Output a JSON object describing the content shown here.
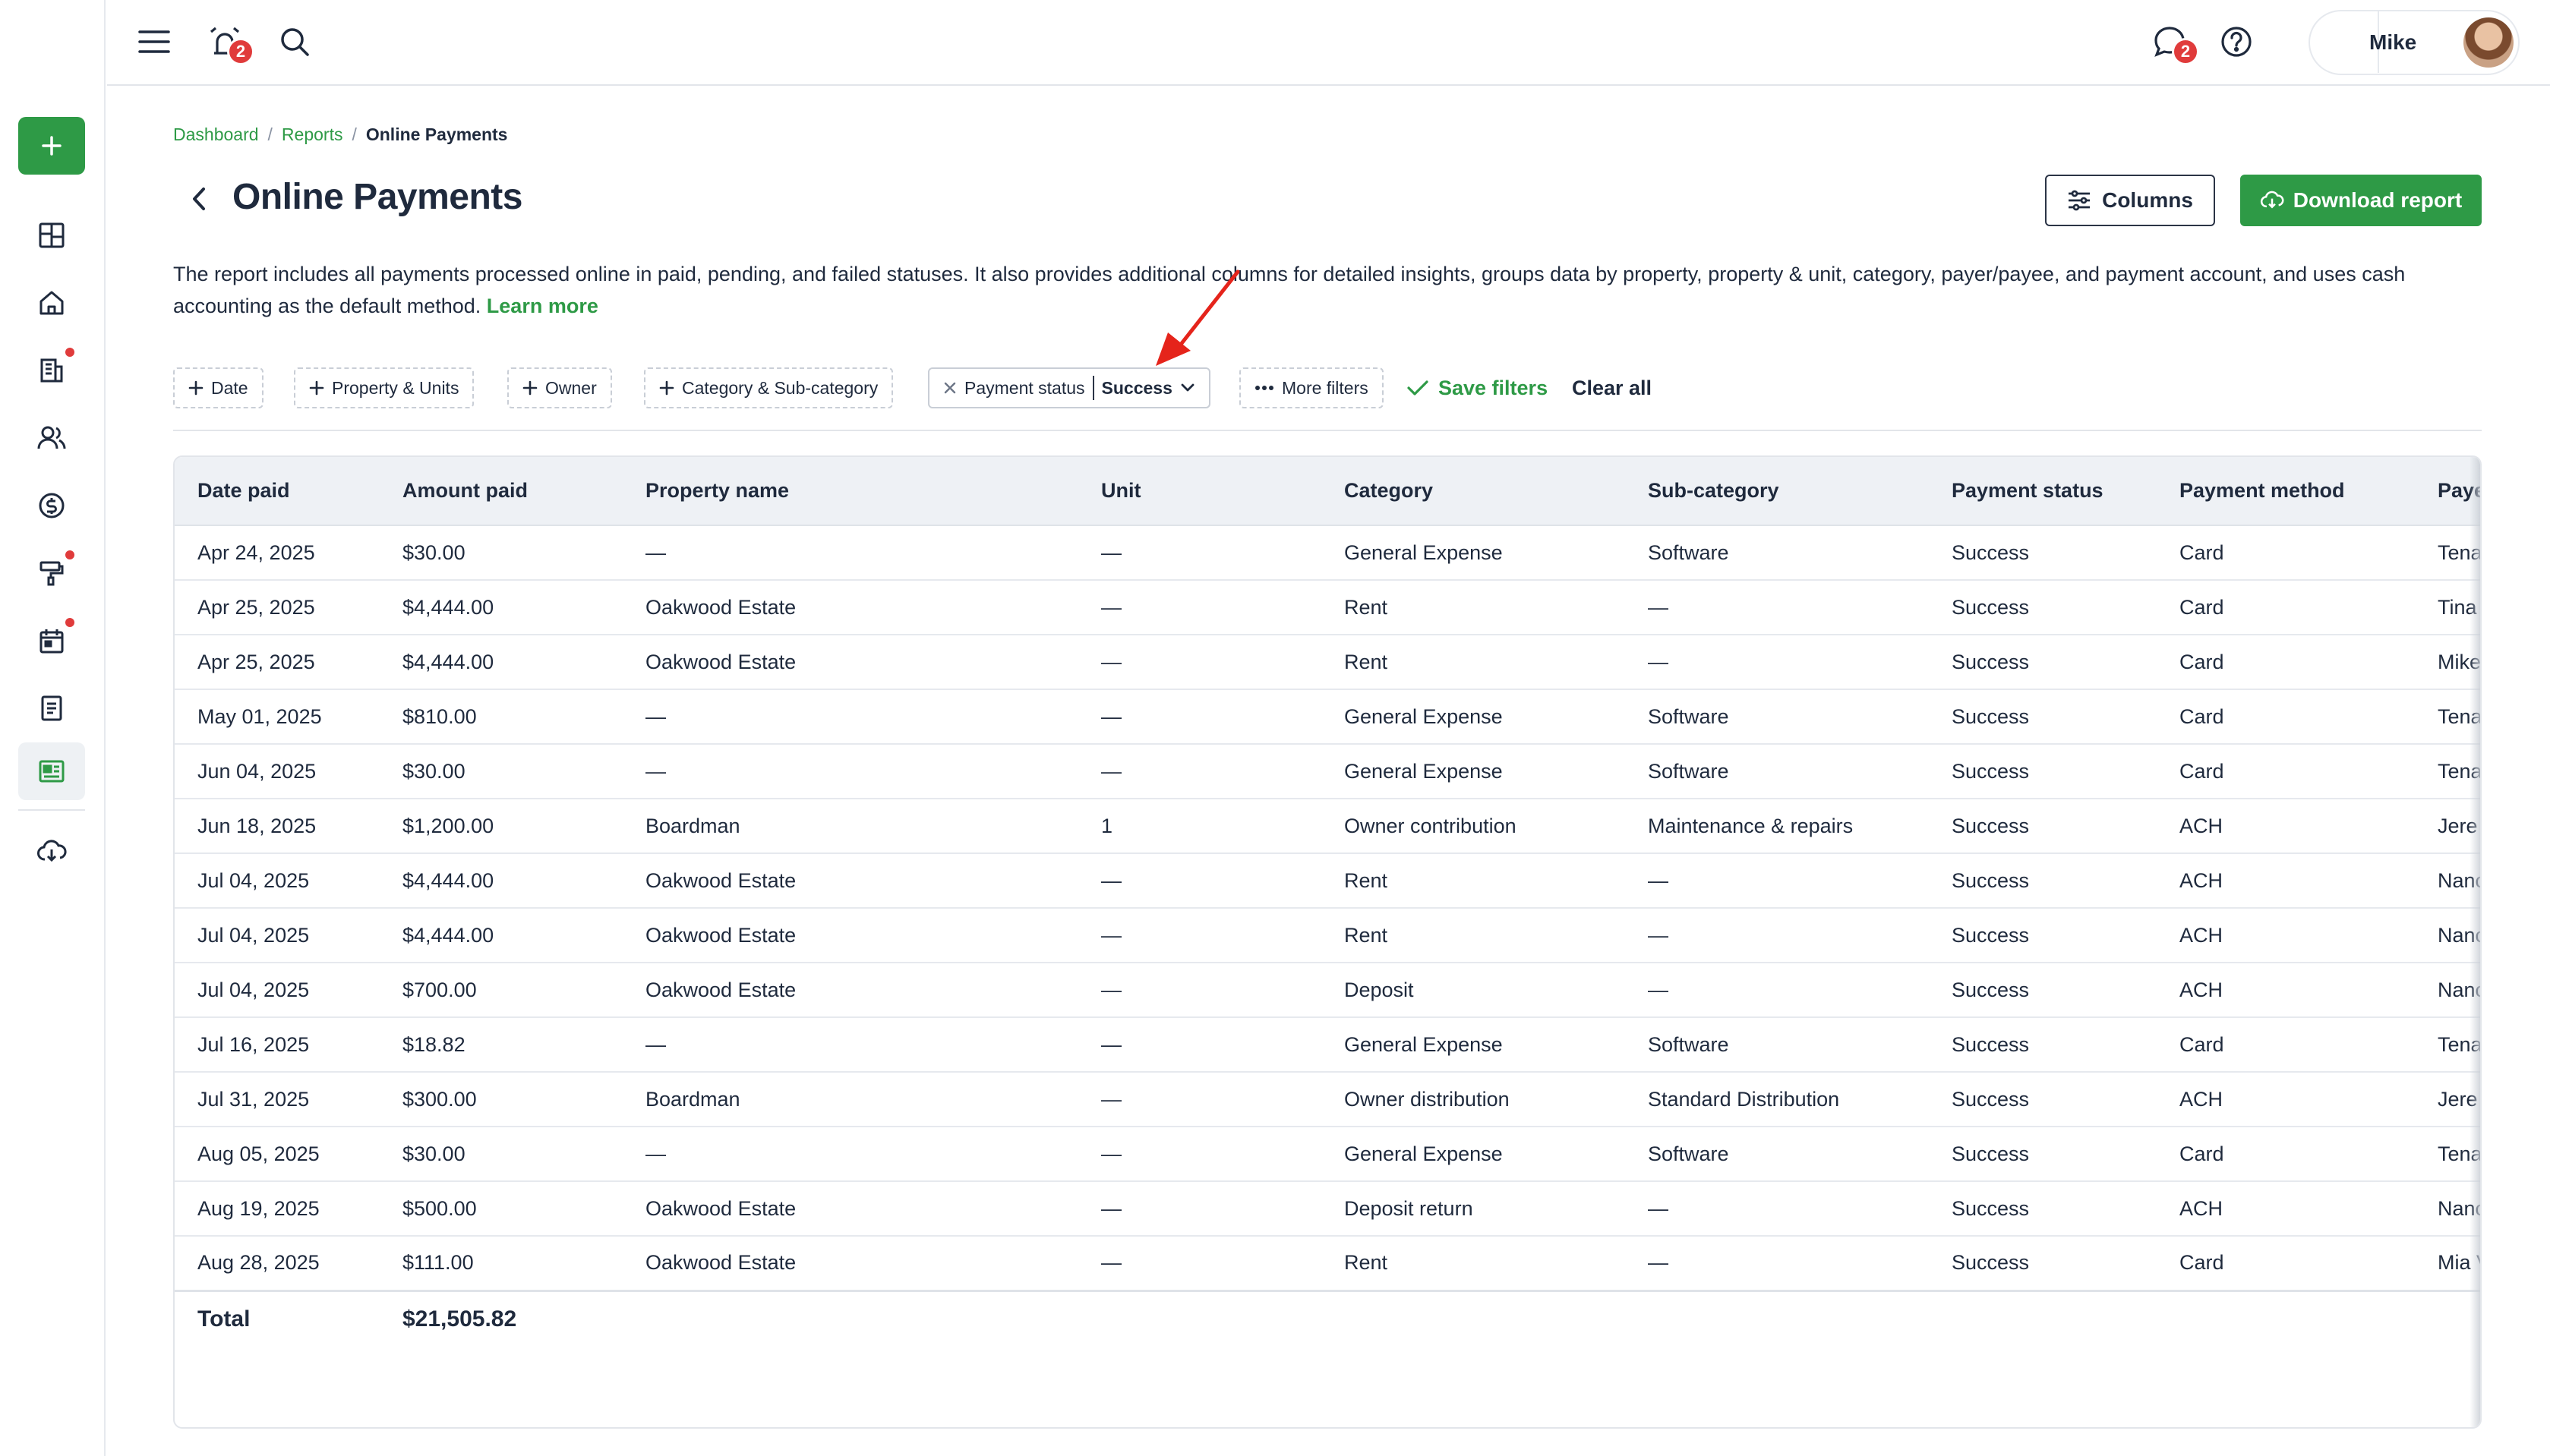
{
  "topbar": {
    "notifications_badge": "2",
    "messages_badge": "2",
    "user_name": "Mike"
  },
  "breadcrumb": {
    "items": [
      "Dashboard",
      "Reports"
    ],
    "current": "Online Payments",
    "separator": "/"
  },
  "page": {
    "title": "Online Payments",
    "columns_button": "Columns",
    "download_button": "Download report",
    "description": "The report includes all payments processed online in paid, pending, and failed statuses. It also provides additional columns for detailed insights, groups data by property, property & unit, category, payer/payee, and payment account, and uses cash accounting as the default method.",
    "learn_more": "Learn more"
  },
  "filters": {
    "date": "Date",
    "property_units": "Property & Units",
    "owner": "Owner",
    "category": "Category & Sub-category",
    "payment_status_label": "Payment status",
    "payment_status_value": "Success",
    "more_filters": "More filters",
    "save_filters": "Save filters",
    "clear_all": "Clear all"
  },
  "table": {
    "headers": [
      "Date paid",
      "Amount paid",
      "Property name",
      "Unit",
      "Category",
      "Sub-category",
      "Payment status",
      "Payment method",
      "Paye"
    ],
    "rows": [
      [
        "Apr 24, 2025",
        "$30.00",
        "—",
        "—",
        "General Expense",
        "Software",
        "Success",
        "Card",
        "Tena"
      ],
      [
        "Apr 25, 2025",
        "$4,444.00",
        "Oakwood Estate",
        "—",
        "Rent",
        "—",
        "Success",
        "Card",
        "Tina"
      ],
      [
        "Apr 25, 2025",
        "$4,444.00",
        "Oakwood Estate",
        "—",
        "Rent",
        "—",
        "Success",
        "Card",
        "Mike"
      ],
      [
        "May 01, 2025",
        "$810.00",
        "—",
        "—",
        "General Expense",
        "Software",
        "Success",
        "Card",
        "Tena"
      ],
      [
        "Jun 04, 2025",
        "$30.00",
        "—",
        "—",
        "General Expense",
        "Software",
        "Success",
        "Card",
        "Tena"
      ],
      [
        "Jun 18, 2025",
        "$1,200.00",
        "Boardman",
        "1",
        "Owner contribution",
        "Maintenance & repairs",
        "Success",
        "ACH",
        "Jere"
      ],
      [
        "Jul 04, 2025",
        "$4,444.00",
        "Oakwood Estate",
        "—",
        "Rent",
        "—",
        "Success",
        "ACH",
        "Nanc"
      ],
      [
        "Jul 04, 2025",
        "$4,444.00",
        "Oakwood Estate",
        "—",
        "Rent",
        "—",
        "Success",
        "ACH",
        "Nanc"
      ],
      [
        "Jul 04, 2025",
        "$700.00",
        "Oakwood Estate",
        "—",
        "Deposit",
        "—",
        "Success",
        "ACH",
        "Nanc"
      ],
      [
        "Jul 16, 2025",
        "$18.82",
        "—",
        "—",
        "General Expense",
        "Software",
        "Success",
        "Card",
        "Tena"
      ],
      [
        "Jul 31, 2025",
        "$300.00",
        "Boardman",
        "—",
        "Owner distribution",
        "Standard Distribution",
        "Success",
        "ACH",
        "Jere"
      ],
      [
        "Aug 05, 2025",
        "$30.00",
        "—",
        "—",
        "General Expense",
        "Software",
        "Success",
        "Card",
        "Tena"
      ],
      [
        "Aug 19, 2025",
        "$500.00",
        "Oakwood Estate",
        "—",
        "Deposit return",
        "—",
        "Success",
        "ACH",
        "Nanc"
      ],
      [
        "Aug 28, 2025",
        "$111.00",
        "Oakwood Estate",
        "—",
        "Rent",
        "—",
        "Success",
        "Card",
        "Mia V"
      ]
    ],
    "total_label": "Total",
    "total_amount": "$21,505.82"
  },
  "colors": {
    "accent_green": "#2e9a46",
    "badge_red": "#e03b3b",
    "text_dark": "#1f2a3d",
    "header_bg": "#eef1f5",
    "annotation_arrow": "#e5241b"
  },
  "icons": {
    "sidebar": [
      "plus-icon",
      "dashboard-grid-icon",
      "home-icon",
      "building-icon",
      "people-icon",
      "dollar-icon",
      "paint-roller-icon",
      "calendar-icon",
      "document-icon",
      "reports-icon",
      "cloud-download-icon"
    ],
    "topbar": [
      "menu-icon",
      "alarm-clock-icon",
      "search-icon",
      "chat-icon",
      "help-icon"
    ]
  }
}
